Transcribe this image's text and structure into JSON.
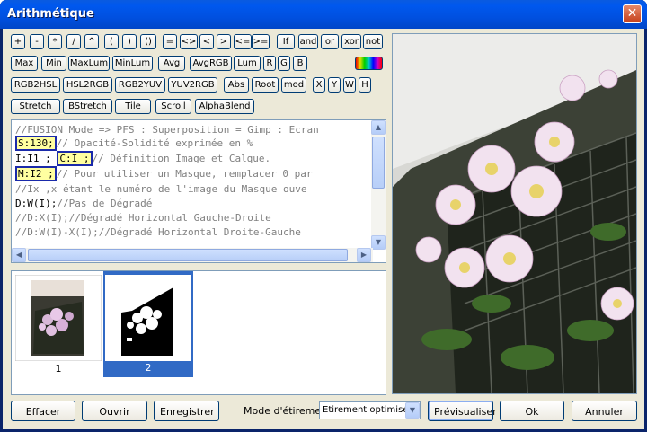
{
  "window": {
    "title": "Arithmétique",
    "close_glyph": "✕"
  },
  "toolbar": {
    "row1": [
      "+",
      "-",
      "*",
      "/",
      "^",
      "(",
      ")",
      "()",
      "=",
      "<>",
      "<",
      ">",
      "<=",
      ">=",
      "If",
      "and",
      "or",
      "xor",
      "not"
    ],
    "row2": [
      "Max",
      "Min",
      "MaxLum",
      "MinLum",
      "Avg",
      "AvgRGB",
      "Lum",
      "R",
      "G",
      "B"
    ],
    "row3": [
      "RGB2HSL",
      "HSL2RGB",
      "RGB2YUV",
      "YUV2RGB",
      "Abs",
      "Root",
      "mod",
      "X",
      "Y",
      "W",
      "H"
    ],
    "row4": [
      "Stretch",
      "BStretch",
      "Tile",
      "Scroll",
      "AlphaBlend"
    ]
  },
  "editor": {
    "l1": "//FUSION Mode => PFS : Superposition = Gimp : Ecran",
    "l2a": "S:130;",
    "l2b": "// Opacité-Solidité exprimée en %",
    "l3a": "I:I1 ;",
    "l3b": "C:I ;",
    "l3c": "// Définition Image et Calque.",
    "l4a": "M:I2 ;",
    "l4b": "// Pour utiliser un Masque, remplacer 0 par",
    "l5": "//Ix ,x étant le numéro de l'image du Masque ouve",
    "l6a": "D:W(I);",
    "l6b": "//Pas de Dégradé",
    "l7": "//D:X(I);//Dégradé Horizontal Gauche-Droite",
    "l8": "//D:W(I)-X(I);//Dégradé Horizontal Droite-Gauche"
  },
  "thumbnails": [
    {
      "label": "1"
    },
    {
      "label": "2"
    }
  ],
  "footer": {
    "effacer": "Effacer",
    "ouvrir": "Ouvrir",
    "enregistrer": "Enregistrer",
    "mode_label": "Mode d'étirement",
    "mode_value": "Etirement optimisé",
    "previsualiser": "Prévisualiser",
    "ok": "Ok",
    "annuler": "Annuler"
  }
}
